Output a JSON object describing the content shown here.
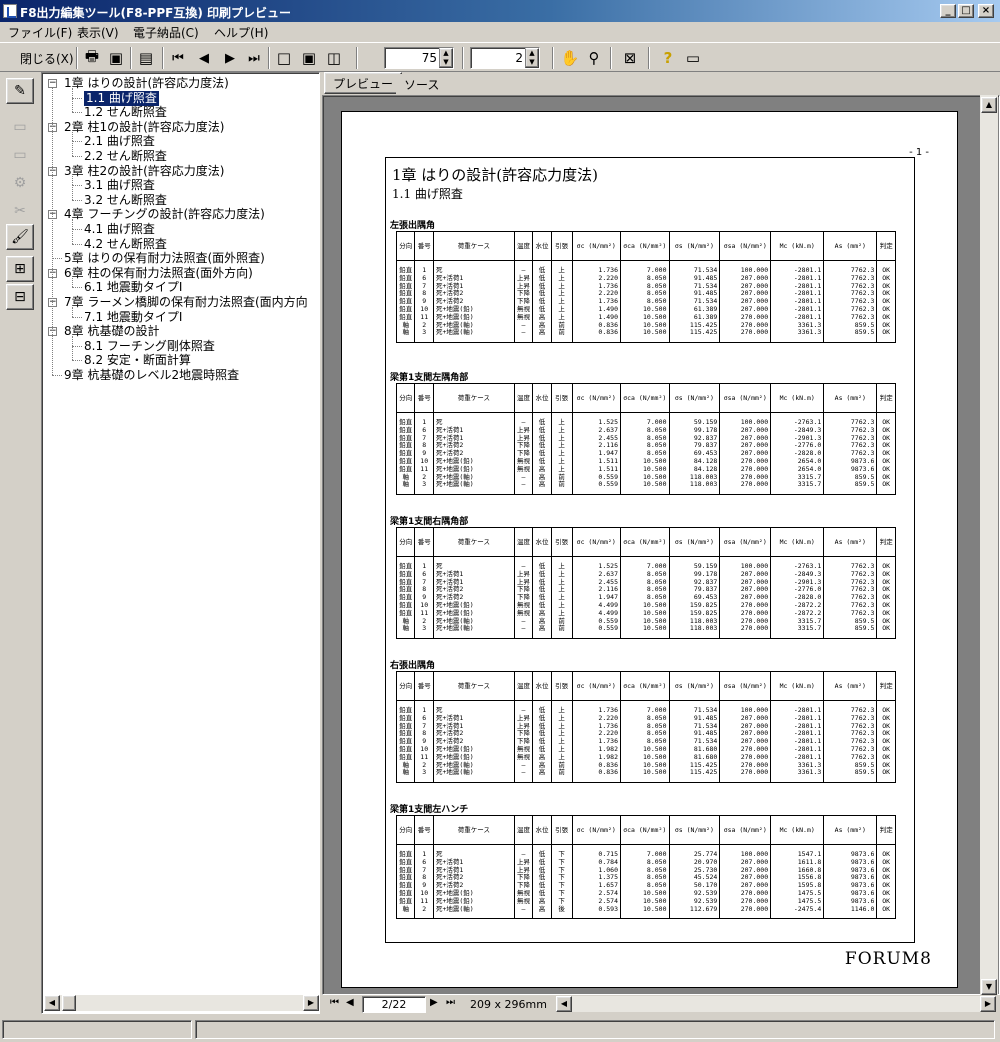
{
  "window": {
    "title": "F8出力編集ツール(F8-PPF互換) 印刷プレビュー",
    "min": "_",
    "max": "□",
    "close": "×"
  },
  "menu": [
    "ファイル(F)",
    "表示(V)",
    "電子納品(C)",
    "ヘルプ(H)"
  ],
  "toolbar": {
    "close_label": "閉じる(X)",
    "zoom_value": "75",
    "page_value": "2"
  },
  "tabs": [
    "プレビュー",
    "ソース"
  ],
  "tree": [
    {
      "label": "1章 はりの設計(許容応力度法)",
      "level": 0
    },
    {
      "label": "1.1 曲げ照査",
      "level": 1,
      "selected": true
    },
    {
      "label": "1.2 せん断照査",
      "level": 1
    },
    {
      "label": "2章 柱1の設計(許容応力度法)",
      "level": 0
    },
    {
      "label": "2.1 曲げ照査",
      "level": 1
    },
    {
      "label": "2.2 せん断照査",
      "level": 1
    },
    {
      "label": "3章 柱2の設計(許容応力度法)",
      "level": 0
    },
    {
      "label": "3.1 曲げ照査",
      "level": 1
    },
    {
      "label": "3.2 せん断照査",
      "level": 1
    },
    {
      "label": "4章 フーチングの設計(許容応力度法)",
      "level": 0
    },
    {
      "label": "4.1 曲げ照査",
      "level": 1
    },
    {
      "label": "4.2 せん断照査",
      "level": 1
    },
    {
      "label": "5章 はりの保有耐力法照査(面外照査)",
      "level": 0,
      "leaf": true
    },
    {
      "label": "6章 柱の保有耐力法照査(面外方向)",
      "level": 0
    },
    {
      "label": "6.1 地震動タイプI",
      "level": 1
    },
    {
      "label": "7章 ラーメン橋脚の保有耐力法照査(面内方向",
      "level": 0
    },
    {
      "label": "7.1 地震動タイプI",
      "level": 1
    },
    {
      "label": "8章 杭基礎の設計",
      "level": 0
    },
    {
      "label": "8.1 フーチング剛体照査",
      "level": 1
    },
    {
      "label": "8.2 安定・断面計算",
      "level": 1
    },
    {
      "label": "9章 杭基礎のレベル2地震時照査",
      "level": 0,
      "leaf": true
    }
  ],
  "document": {
    "page_number": "- 1 -",
    "chapter_title": "1章 はりの設計(許容応力度法)",
    "section_title": "1.1 曲げ照査",
    "footer": "FORUM8",
    "headers": [
      "分向",
      "番号",
      "荷重ケース",
      "温度",
      "水位",
      "引張",
      "σc (N/mm²)",
      "σca (N/mm²)",
      "σs (N/mm²)",
      "σsa (N/mm²)",
      "Mc (kN.m)",
      "As (mm²)",
      "判定"
    ],
    "tables": [
      {
        "label": "左張出隅角",
        "rows": [
          [
            "鉛直",
            "1",
            "死",
            "—",
            "低",
            "上",
            "1.736",
            "7.000",
            "71.534",
            "100.000",
            "-2801.1",
            "7762.3",
            "OK"
          ],
          [
            "鉛直",
            "6",
            "死+活荷1",
            "上昇",
            "低",
            "上",
            "2.220",
            "8.050",
            "91.485",
            "207.000",
            "-2801.1",
            "7762.3",
            "OK"
          ],
          [
            "鉛直",
            "7",
            "死+活荷1",
            "上昇",
            "低",
            "上",
            "1.736",
            "8.050",
            "71.534",
            "207.000",
            "-2801.1",
            "7762.3",
            "OK"
          ],
          [
            "鉛直",
            "8",
            "死+活荷2",
            "下降",
            "低",
            "上",
            "2.220",
            "8.050",
            "91.485",
            "207.000",
            "-2801.1",
            "7762.3",
            "OK"
          ],
          [
            "鉛直",
            "9",
            "死+活荷2",
            "下降",
            "低",
            "上",
            "1.736",
            "8.050",
            "71.534",
            "207.000",
            "-2801.1",
            "7762.3",
            "OK"
          ],
          [
            "鉛直",
            "10",
            "死+地震(鉛)",
            "無視",
            "低",
            "上",
            "1.490",
            "10.500",
            "61.389",
            "207.000",
            "-2801.1",
            "7762.3",
            "OK"
          ],
          [
            "鉛直",
            "11",
            "死+地震(鉛)",
            "無視",
            "高",
            "上",
            "1.490",
            "10.500",
            "61.389",
            "270.000",
            "-2801.1",
            "7762.3",
            "OK"
          ],
          [
            "軸",
            "2",
            "死+地震(軸)",
            "—",
            "高",
            "前",
            "0.836",
            "10.500",
            "115.425",
            "270.000",
            "3361.3",
            "859.5",
            "OK"
          ],
          [
            "軸",
            "3",
            "死+地震(軸)",
            "—",
            "高",
            "前",
            "0.836",
            "10.500",
            "115.425",
            "270.000",
            "3361.3",
            "859.5",
            "OK"
          ]
        ]
      },
      {
        "label": "梁第1支間左隅角部",
        "rows": [
          [
            "鉛直",
            "1",
            "死",
            "—",
            "低",
            "上",
            "1.525",
            "7.000",
            "59.159",
            "100.000",
            "-2763.1",
            "7762.3",
            "OK"
          ],
          [
            "鉛直",
            "6",
            "死+活荷1",
            "上昇",
            "低",
            "上",
            "2.637",
            "8.050",
            "99.178",
            "207.000",
            "-2849.3",
            "7762.3",
            "OK"
          ],
          [
            "鉛直",
            "7",
            "死+活荷1",
            "上昇",
            "低",
            "上",
            "2.455",
            "8.050",
            "92.837",
            "207.000",
            "-2901.3",
            "7762.3",
            "OK"
          ],
          [
            "鉛直",
            "8",
            "死+活荷2",
            "下降",
            "低",
            "上",
            "2.116",
            "8.050",
            "79.837",
            "207.000",
            "-2776.0",
            "7762.3",
            "OK"
          ],
          [
            "鉛直",
            "9",
            "死+活荷2",
            "下降",
            "低",
            "上",
            "1.947",
            "8.050",
            "69.453",
            "207.000",
            "-2828.0",
            "7762.3",
            "OK"
          ],
          [
            "鉛直",
            "10",
            "死+地震(鉛)",
            "無視",
            "低",
            "上",
            "1.511",
            "10.500",
            "84.128",
            "270.000",
            "2654.0",
            "9873.6",
            "OK"
          ],
          [
            "鉛直",
            "11",
            "死+地震(鉛)",
            "無視",
            "高",
            "上",
            "1.511",
            "10.500",
            "84.128",
            "270.000",
            "2654.0",
            "9873.6",
            "OK"
          ],
          [
            "軸",
            "2",
            "死+地震(軸)",
            "—",
            "高",
            "前",
            "0.559",
            "10.500",
            "118.003",
            "270.000",
            "3315.7",
            "859.5",
            "OK"
          ],
          [
            "軸",
            "3",
            "死+地震(軸)",
            "—",
            "高",
            "前",
            "0.559",
            "10.500",
            "118.003",
            "270.000",
            "3315.7",
            "859.5",
            "OK"
          ]
        ]
      },
      {
        "label": "梁第1支間右隅角部",
        "rows": [
          [
            "鉛直",
            "1",
            "死",
            "—",
            "低",
            "上",
            "1.525",
            "7.000",
            "59.159",
            "100.000",
            "-2763.1",
            "7762.3",
            "OK"
          ],
          [
            "鉛直",
            "6",
            "死+活荷1",
            "上昇",
            "低",
            "上",
            "2.637",
            "8.050",
            "99.178",
            "207.000",
            "-2849.3",
            "7762.3",
            "OK"
          ],
          [
            "鉛直",
            "7",
            "死+活荷1",
            "上昇",
            "低",
            "上",
            "2.455",
            "8.050",
            "92.837",
            "207.000",
            "-2901.3",
            "7762.3",
            "OK"
          ],
          [
            "鉛直",
            "8",
            "死+活荷2",
            "下降",
            "低",
            "上",
            "2.116",
            "8.050",
            "79.837",
            "207.000",
            "-2776.0",
            "7762.3",
            "OK"
          ],
          [
            "鉛直",
            "9",
            "死+活荷2",
            "下降",
            "低",
            "上",
            "1.947",
            "8.050",
            "69.453",
            "207.000",
            "-2828.0",
            "7762.3",
            "OK"
          ],
          [
            "鉛直",
            "10",
            "死+地震(鉛)",
            "無視",
            "低",
            "上",
            "4.499",
            "10.500",
            "159.825",
            "270.000",
            "-2872.2",
            "7762.3",
            "OK"
          ],
          [
            "鉛直",
            "11",
            "死+地震(鉛)",
            "無視",
            "高",
            "上",
            "4.499",
            "10.500",
            "159.825",
            "270.000",
            "-2872.2",
            "7762.3",
            "OK"
          ],
          [
            "軸",
            "2",
            "死+地震(軸)",
            "—",
            "高",
            "前",
            "0.559",
            "10.500",
            "118.003",
            "270.000",
            "3315.7",
            "859.5",
            "OK"
          ],
          [
            "軸",
            "3",
            "死+地震(軸)",
            "—",
            "高",
            "前",
            "0.559",
            "10.500",
            "118.003",
            "270.000",
            "3315.7",
            "859.5",
            "OK"
          ]
        ]
      },
      {
        "label": "右張出隅角",
        "rows": [
          [
            "鉛直",
            "1",
            "死",
            "—",
            "低",
            "上",
            "1.736",
            "7.000",
            "71.534",
            "100.000",
            "-2801.1",
            "7762.3",
            "OK"
          ],
          [
            "鉛直",
            "6",
            "死+活荷1",
            "上昇",
            "低",
            "上",
            "2.220",
            "8.050",
            "91.485",
            "207.000",
            "-2801.1",
            "7762.3",
            "OK"
          ],
          [
            "鉛直",
            "7",
            "死+活荷1",
            "上昇",
            "低",
            "上",
            "1.736",
            "8.050",
            "71.534",
            "207.000",
            "-2801.1",
            "7762.3",
            "OK"
          ],
          [
            "鉛直",
            "8",
            "死+活荷2",
            "下降",
            "低",
            "上",
            "2.220",
            "8.050",
            "91.485",
            "207.000",
            "-2801.1",
            "7762.3",
            "OK"
          ],
          [
            "鉛直",
            "9",
            "死+活荷2",
            "下降",
            "低",
            "上",
            "1.736",
            "8.050",
            "71.534",
            "207.000",
            "-2801.1",
            "7762.3",
            "OK"
          ],
          [
            "鉛直",
            "10",
            "死+地震(鉛)",
            "無視",
            "低",
            "上",
            "1.982",
            "10.500",
            "81.680",
            "270.000",
            "-2801.1",
            "7762.3",
            "OK"
          ],
          [
            "鉛直",
            "11",
            "死+地震(鉛)",
            "無視",
            "高",
            "上",
            "1.982",
            "10.500",
            "81.680",
            "270.000",
            "-2801.1",
            "7762.3",
            "OK"
          ],
          [
            "軸",
            "2",
            "死+地震(軸)",
            "—",
            "高",
            "前",
            "0.836",
            "10.500",
            "115.425",
            "270.000",
            "3361.3",
            "859.5",
            "OK"
          ],
          [
            "軸",
            "3",
            "死+地震(軸)",
            "—",
            "高",
            "前",
            "0.836",
            "10.500",
            "115.425",
            "270.000",
            "3361.3",
            "859.5",
            "OK"
          ]
        ]
      },
      {
        "label": "梁第1支間左ハンチ",
        "rows": [
          [
            "鉛直",
            "1",
            "死",
            "—",
            "低",
            "下",
            "0.715",
            "7.000",
            "25.774",
            "100.000",
            "1547.1",
            "9873.6",
            "OK"
          ],
          [
            "鉛直",
            "6",
            "死+活荷1",
            "上昇",
            "低",
            "下",
            "0.784",
            "8.050",
            "20.970",
            "207.000",
            "1611.8",
            "9873.6",
            "OK"
          ],
          [
            "鉛直",
            "7",
            "死+活荷1",
            "上昇",
            "低",
            "下",
            "1.060",
            "8.050",
            "25.730",
            "207.000",
            "1660.8",
            "9873.6",
            "OK"
          ],
          [
            "鉛直",
            "8",
            "死+活荷2",
            "下降",
            "低",
            "下",
            "1.375",
            "8.050",
            "45.524",
            "207.000",
            "1556.8",
            "9873.6",
            "OK"
          ],
          [
            "鉛直",
            "9",
            "死+活荷2",
            "下降",
            "低",
            "下",
            "1.657",
            "8.050",
            "50.170",
            "207.000",
            "1595.8",
            "9873.6",
            "OK"
          ],
          [
            "鉛直",
            "10",
            "死+地震(鉛)",
            "無視",
            "低",
            "下",
            "2.574",
            "10.500",
            "92.539",
            "270.000",
            "1475.5",
            "9873.6",
            "OK"
          ],
          [
            "鉛直",
            "11",
            "死+地震(鉛)",
            "無視",
            "高",
            "下",
            "2.574",
            "10.500",
            "92.539",
            "270.000",
            "1475.5",
            "9873.6",
            "OK"
          ],
          [
            "軸",
            "2",
            "死+地震(軸)",
            "—",
            "高",
            "後",
            "0.593",
            "10.500",
            "112.679",
            "270.000",
            "-2475.4",
            "1146.0",
            "OK"
          ]
        ]
      }
    ]
  },
  "navigation": {
    "page_display": "2/22",
    "paper_size": "209 x 296mm"
  }
}
